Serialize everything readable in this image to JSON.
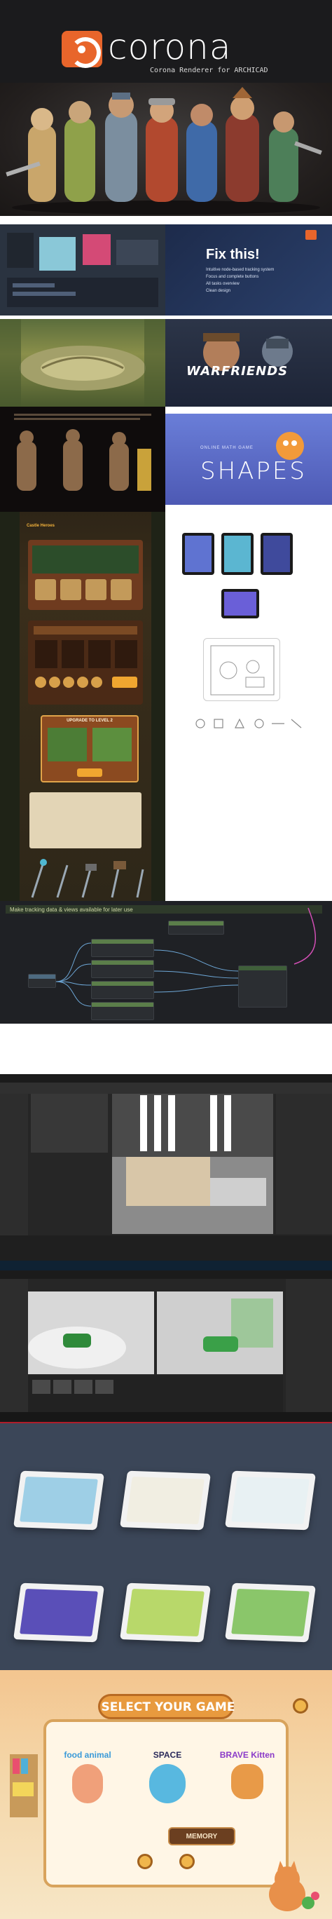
{
  "header": {
    "brand": "corona",
    "subtitle": "Corona Renderer for ARCHICAD"
  },
  "fix_panel": {
    "title": "Fix this!",
    "items": [
      "Intuitive node-based tracking system",
      "Focus and complete buttons",
      "All tasks overview",
      "Clean design"
    ]
  },
  "warfriends": {
    "title": "WARFRIENDS"
  },
  "shapes": {
    "small": "ONLINE MATH GAME",
    "title": "SHAPES"
  },
  "castle": {
    "intro_highlight": "Castle Heroes",
    "dialog_title": "UPGRADE TO LEVEL 2"
  },
  "nodegraph": {
    "title": "Make tracking data & views available for later use"
  },
  "select_game": {
    "title": "SELECT YOUR GAME",
    "games": [
      "food animal",
      "SPACE",
      "BRAVE Kitten"
    ],
    "button": "MEMORY"
  },
  "colors": {
    "brand_orange": "#e8652b",
    "header_bg": "#1b1b1d",
    "accent_blue": "#2a3f6a"
  }
}
